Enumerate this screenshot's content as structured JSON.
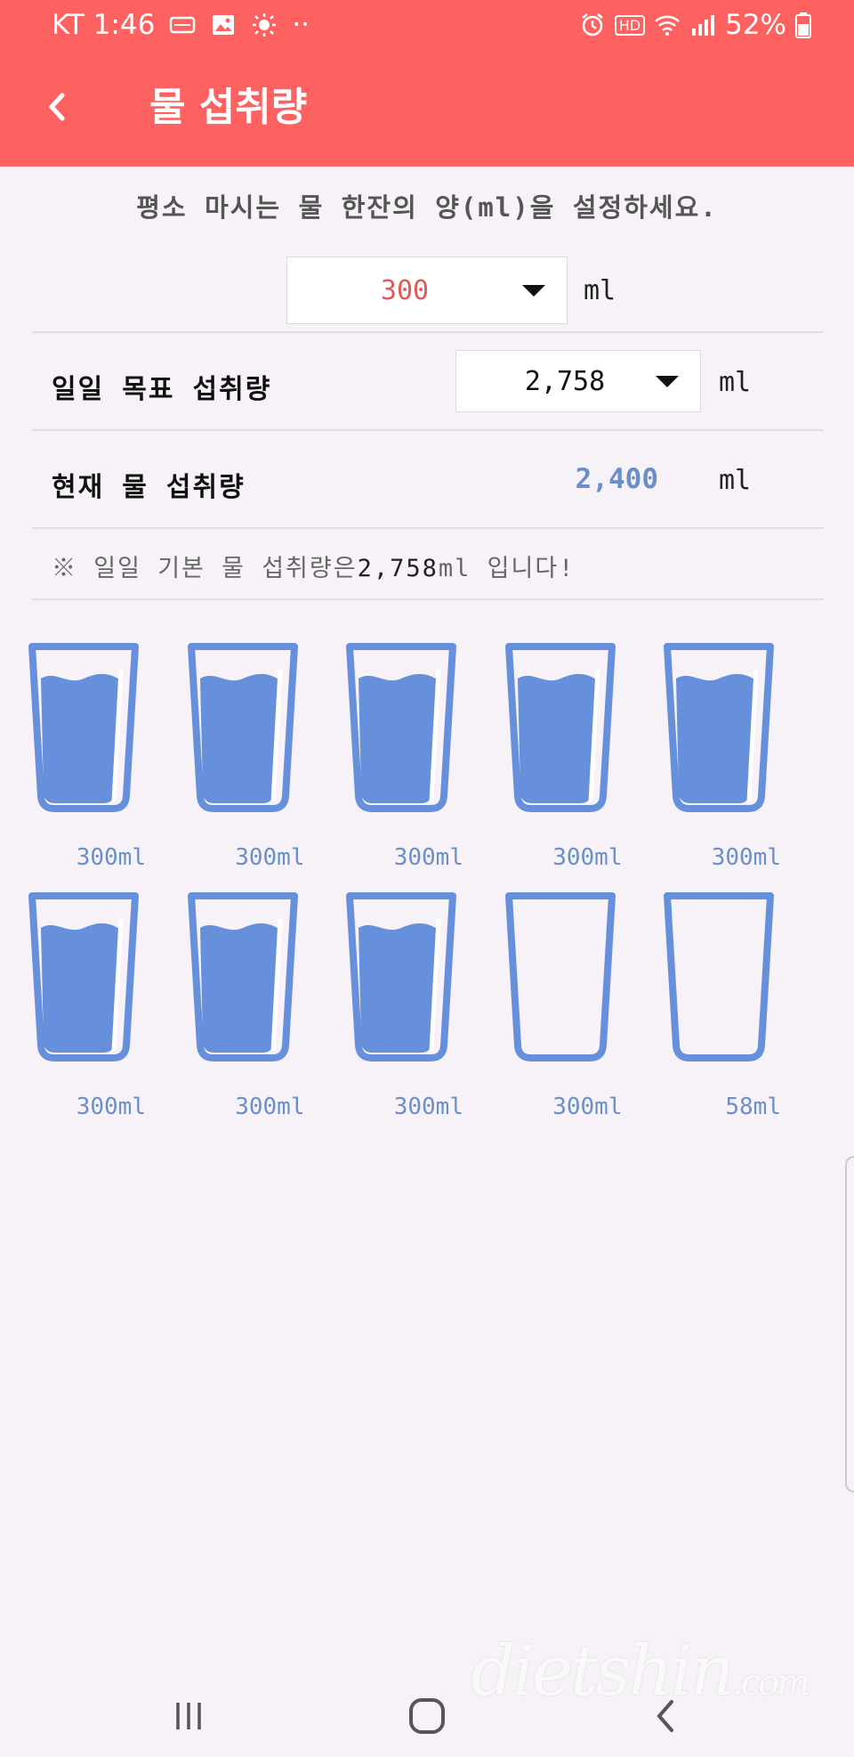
{
  "status_bar": {
    "carrier_time": "KT 1:46",
    "dots": "··",
    "hd": "HD",
    "battery": "52%"
  },
  "header": {
    "title": "물 섭취량",
    "background": "#fd6260"
  },
  "settings": {
    "prompt": "평소 마시는 물 한잔의 양(ml)을 설정하세요.",
    "cup_size_value": "300",
    "cup_size_unit": "ml",
    "goal_label": "일일 목표 섭취량",
    "goal_value": "2,758",
    "goal_unit": "ml",
    "current_label": "현재 물 섭취량",
    "current_value": "2,400",
    "current_unit": "ml",
    "notice_prefix": "※ 일일 기본 물 섭취량은",
    "notice_value": "2,758",
    "notice_suffix": "ml 입니다!"
  },
  "cups": [
    {
      "label": "300ml",
      "filled": true
    },
    {
      "label": "300ml",
      "filled": true
    },
    {
      "label": "300ml",
      "filled": true
    },
    {
      "label": "300ml",
      "filled": true
    },
    {
      "label": "300ml",
      "filled": true
    },
    {
      "label": "300ml",
      "filled": true
    },
    {
      "label": "300ml",
      "filled": true
    },
    {
      "label": "300ml",
      "filled": true
    },
    {
      "label": "300ml",
      "filled": false
    },
    {
      "label": "58ml",
      "filled": false
    }
  ],
  "colors": {
    "accent_blue": "#6690dc",
    "label_blue": "#6b90c8",
    "selected_red": "#e05a57"
  },
  "icons": [
    "back-arrow-icon",
    "recent-apps-icon",
    "home-icon",
    "back-nav-icon"
  ],
  "watermark": {
    "main": "dietshin",
    "suffix": ".com"
  }
}
